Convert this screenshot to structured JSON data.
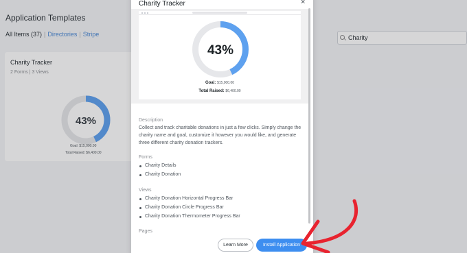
{
  "background": {
    "page_title": "Application Templates",
    "filters": {
      "all": "All Items (37)",
      "sep": "|",
      "directories": "Directories",
      "stripe": "Stripe"
    },
    "search": {
      "value": "Charity"
    },
    "card": {
      "title": "Charity Tracker",
      "meta": "2 Forms | 3 Views",
      "percent_label": "43%",
      "percent_value": 43,
      "goal": "Goal: $15,000.00",
      "raised": "Total Raised: $6,400.00"
    }
  },
  "modal": {
    "title": "Charity Tracker",
    "close_label": "×",
    "preview": {
      "percent_label": "43%",
      "percent_value": 43,
      "goal_label": "Goal:",
      "goal_amount": "$15,000.00",
      "raised_label": "Total Raised:",
      "raised_amount": "$6,400.00"
    },
    "description_heading": "Description",
    "description_text": "Collect and track charitable donations in just a few clicks. Simply change the charity name and goal, customize it however you would like, and generate three different charity donation trackers.",
    "forms_heading": "Forms",
    "forms": [
      "Charity Details",
      "Charity Donation"
    ],
    "views_heading": "Views",
    "views": [
      "Charity Donation Horizontal Progress Bar",
      "Charity Donation Circle Progress Bar",
      "Charity Donation Thermometer Progress Bar"
    ],
    "pages_heading": "Pages",
    "learn_more_label": "Learn More",
    "install_label": "Install Application"
  },
  "colors": {
    "accent": "#3d8ef0",
    "ring_fill": "#5ea1ef",
    "ring_track": "#e6e7ea",
    "annotation": "#e8232f"
  },
  "icons": [
    "search-icon",
    "close-icon",
    "annotation-arrow-icon"
  ]
}
